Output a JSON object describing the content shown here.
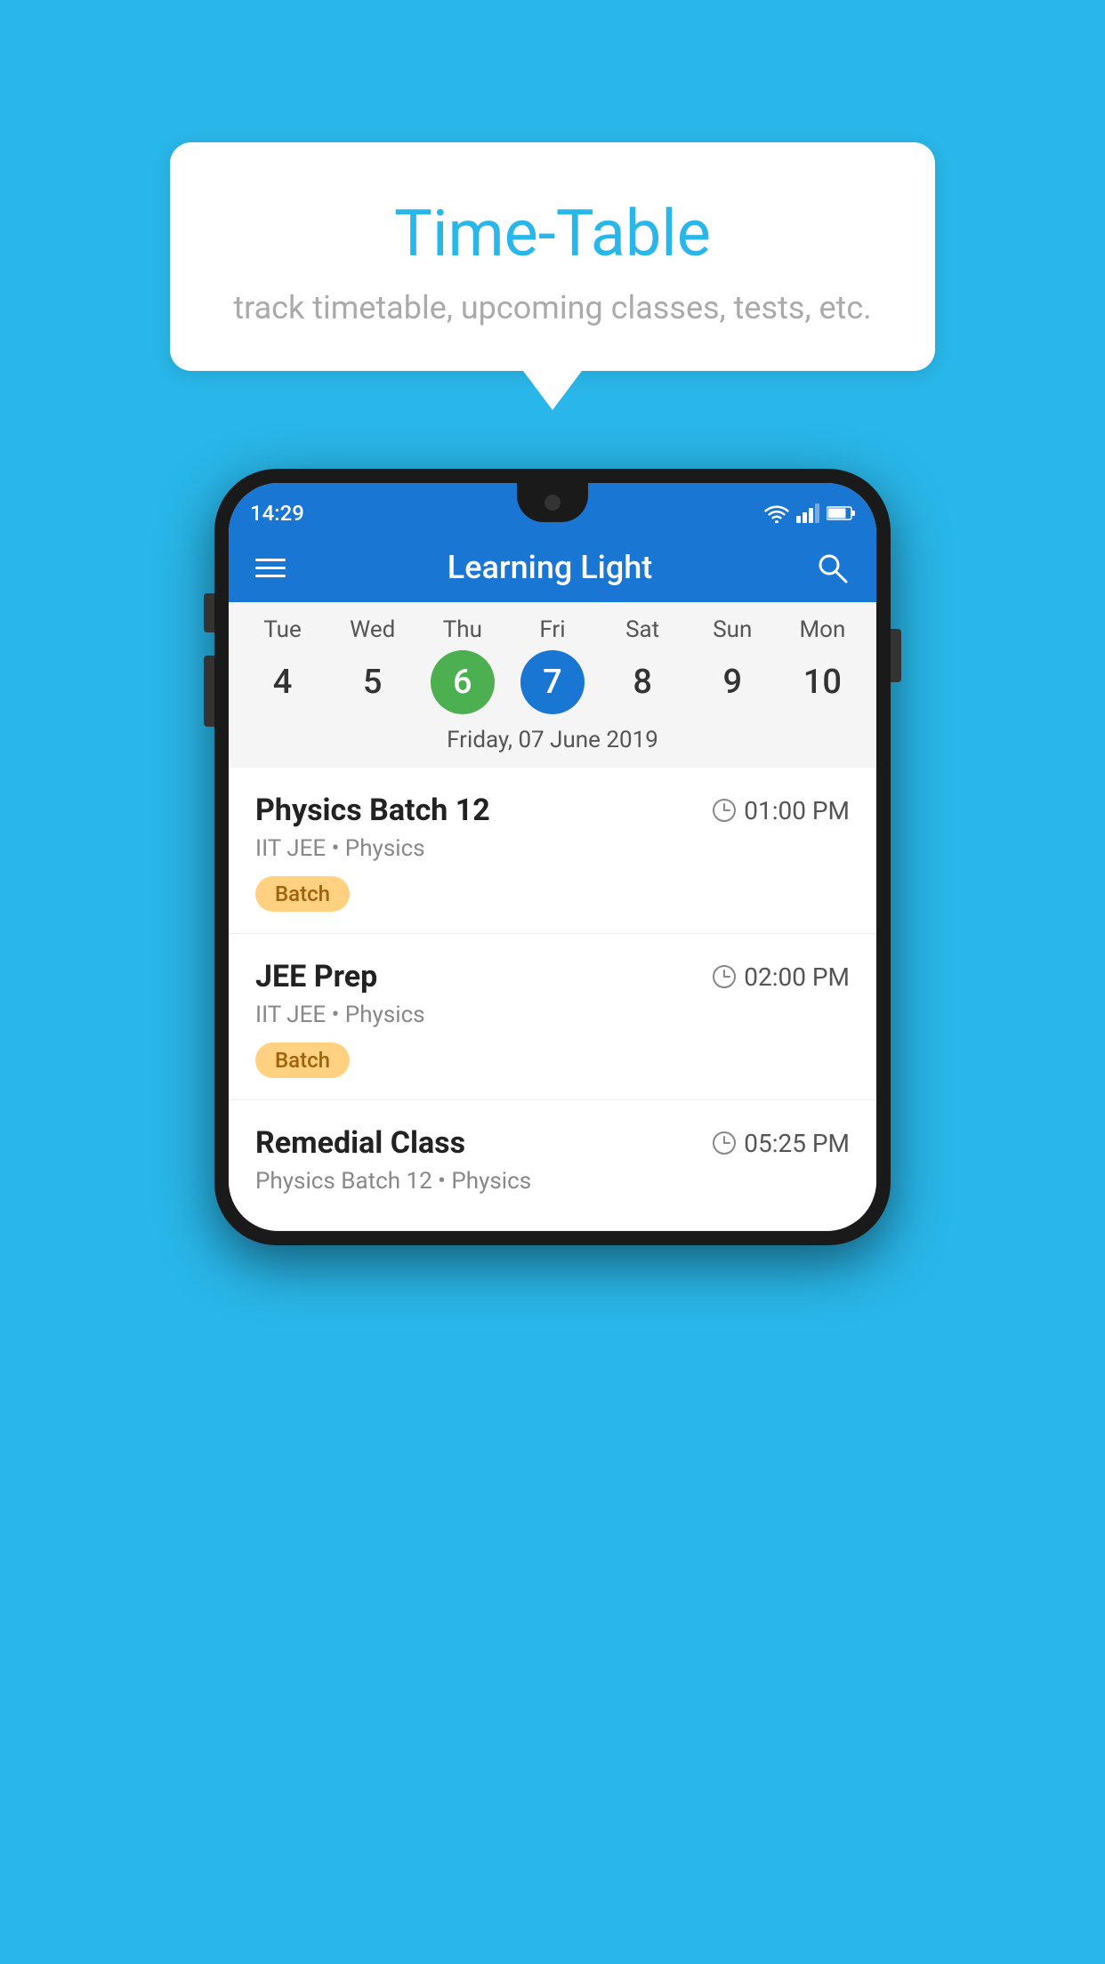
{
  "background_color": "#29b6e8",
  "tooltip": {
    "title": "Time-Table",
    "subtitle": "track timetable, upcoming classes, tests, etc."
  },
  "phone": {
    "status_bar": {
      "time": "14:29"
    },
    "app_header": {
      "title": "Learning Light"
    },
    "calendar": {
      "days": [
        {
          "label": "Tue",
          "num": "4",
          "state": "normal"
        },
        {
          "label": "Wed",
          "num": "5",
          "state": "normal"
        },
        {
          "label": "Thu",
          "num": "6",
          "state": "today"
        },
        {
          "label": "Fri",
          "num": "7",
          "state": "selected"
        },
        {
          "label": "Sat",
          "num": "8",
          "state": "normal"
        },
        {
          "label": "Sun",
          "num": "9",
          "state": "normal"
        },
        {
          "label": "Mon",
          "num": "10",
          "state": "normal"
        }
      ],
      "selected_date_label": "Friday, 07 June 2019"
    },
    "schedule": [
      {
        "title": "Physics Batch 12",
        "time": "01:00 PM",
        "subtitle": "IIT JEE • Physics",
        "badge": "Batch"
      },
      {
        "title": "JEE Prep",
        "time": "02:00 PM",
        "subtitle": "IIT JEE • Physics",
        "badge": "Batch"
      },
      {
        "title": "Remedial Class",
        "time": "05:25 PM",
        "subtitle": "Physics Batch 12 • Physics",
        "badge": null
      }
    ]
  }
}
